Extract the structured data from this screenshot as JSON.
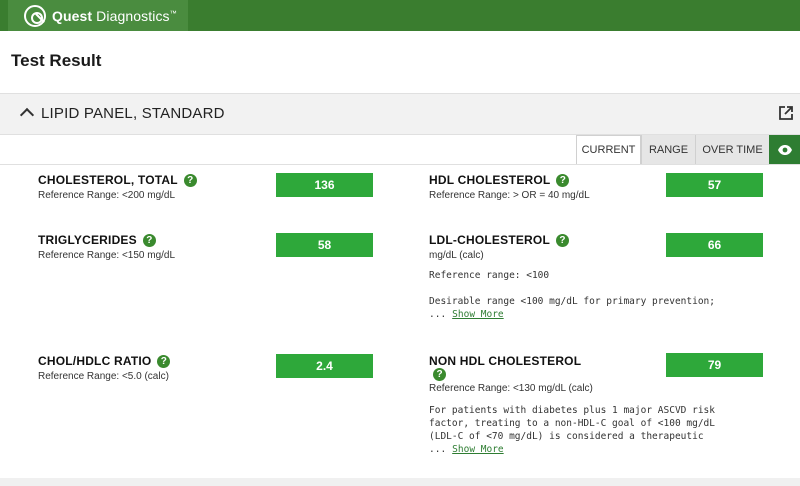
{
  "brand": {
    "name_bold": "Quest",
    "name_rest": " Diagnostics",
    "tm": "™"
  },
  "page": {
    "title": "Test Result"
  },
  "panel": {
    "title": "LIPID PANEL, STANDARD"
  },
  "tabs": [
    {
      "label": "CURRENT",
      "active": true
    },
    {
      "label": "RANGE",
      "active": false
    },
    {
      "label": "OVER TIME",
      "active": false
    }
  ],
  "accent_color": "#2ea83a",
  "results": {
    "chol_total": {
      "name": "CHOLESTEROL, TOTAL",
      "ref": "Reference Range: <200 mg/dL",
      "value": "136"
    },
    "hdl": {
      "name": "HDL CHOLESTEROL",
      "ref": "Reference Range: > OR = 40 mg/dL",
      "value": "57"
    },
    "trig": {
      "name": "TRIGLYCERIDES",
      "ref": "Reference Range: <150 mg/dL",
      "value": "58"
    },
    "ldl": {
      "name": "LDL-CHOLESTEROL",
      "unit": "mg/dL (calc)",
      "note1": "Reference range: <100",
      "note2": "Desirable range <100 mg/dL for primary prevention;",
      "ellipsis": "...",
      "show_more": "Show More",
      "value": "66"
    },
    "ratio": {
      "name": "CHOL/HDLC RATIO",
      "ref": "Reference Range: <5.0 (calc)",
      "value": "2.4"
    },
    "nonhdl": {
      "name": "NON HDL CHOLESTEROL",
      "ref": "Reference Range: <130 mg/dL (calc)",
      "note_lines": [
        "For patients with diabetes plus 1 major ASCVD risk",
        "factor, treating to a non-HDL-C goal of <100 mg/dL",
        "(LDL-C of <70 mg/dL) is considered a therapeutic"
      ],
      "ellipsis": "...",
      "show_more": "Show More",
      "value": "79"
    }
  },
  "icons": {
    "help": "?"
  }
}
